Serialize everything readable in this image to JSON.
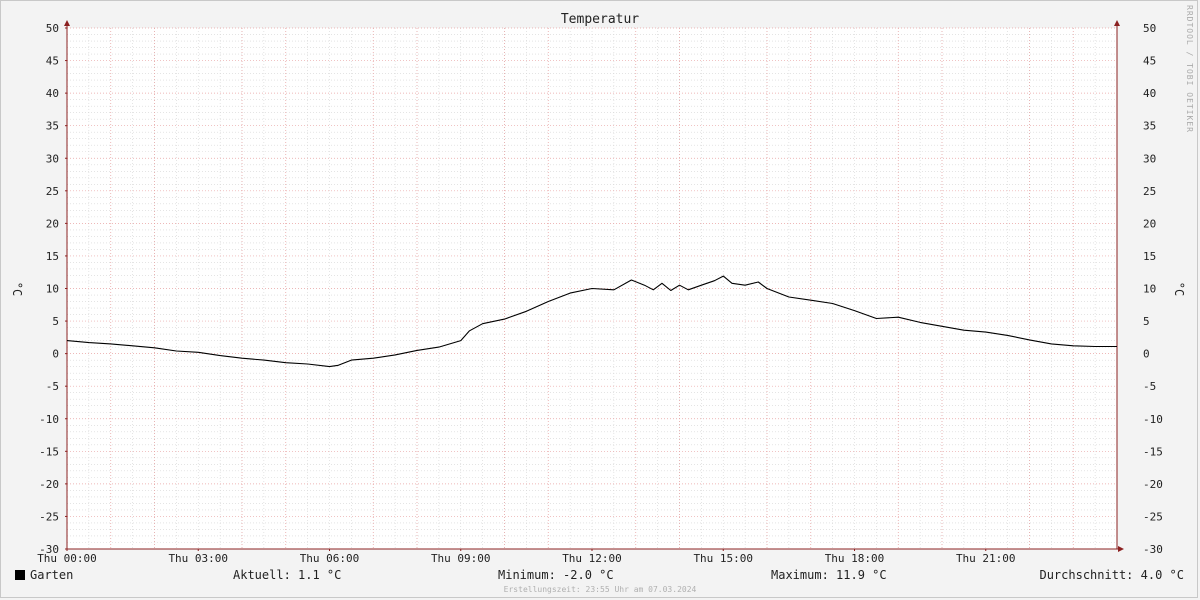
{
  "chart_data": {
    "type": "line",
    "title": "Temperatur",
    "ylabel": "°C",
    "ylabel_right": "°C",
    "ylim": [
      -30,
      50
    ],
    "y_ticks": [
      50,
      45,
      40,
      35,
      30,
      25,
      20,
      15,
      10,
      5,
      0,
      -5,
      -10,
      -15,
      -20,
      -25,
      -30
    ],
    "x_ticks": [
      {
        "hour": 0,
        "label": "Thu 00:00"
      },
      {
        "hour": 3,
        "label": "Thu 03:00"
      },
      {
        "hour": 6,
        "label": "Thu 06:00"
      },
      {
        "hour": 9,
        "label": "Thu 09:00"
      },
      {
        "hour": 12,
        "label": "Thu 12:00"
      },
      {
        "hour": 15,
        "label": "Thu 15:00"
      },
      {
        "hour": 18,
        "label": "Thu 18:00"
      },
      {
        "hour": 21,
        "label": "Thu 21:00"
      }
    ],
    "xlim_hours": [
      0,
      24
    ],
    "grid": true,
    "series": [
      {
        "name": "Garten",
        "color": "#000000",
        "x_hours": [
          0,
          0.5,
          1,
          1.5,
          2,
          2.5,
          3,
          3.5,
          4,
          4.5,
          5,
          5.5,
          6,
          6.2,
          6.5,
          7,
          7.5,
          8,
          8.5,
          9,
          9.2,
          9.5,
          10,
          10.5,
          11,
          11.5,
          12,
          12.5,
          12.9,
          13.2,
          13.4,
          13.6,
          13.8,
          14.0,
          14.2,
          14.5,
          14.8,
          15.0,
          15.2,
          15.5,
          15.8,
          16,
          16.5,
          17,
          17.5,
          18,
          18.5,
          19,
          19.5,
          20,
          20.5,
          21,
          21.5,
          22,
          22.5,
          23,
          23.5,
          24
        ],
        "values": [
          2.0,
          1.7,
          1.5,
          1.2,
          0.9,
          0.4,
          0.2,
          -0.3,
          -0.7,
          -1.0,
          -1.4,
          -1.6,
          -2.0,
          -1.8,
          -1.0,
          -0.7,
          -0.2,
          0.5,
          1.0,
          2.0,
          3.5,
          4.6,
          5.3,
          6.5,
          8.0,
          9.3,
          10.0,
          9.8,
          11.3,
          10.5,
          9.8,
          10.8,
          9.7,
          10.5,
          9.8,
          10.5,
          11.2,
          11.9,
          10.8,
          10.5,
          11.0,
          10.0,
          8.7,
          8.2,
          7.7,
          6.6,
          5.4,
          5.6,
          4.8,
          4.2,
          3.6,
          3.3,
          2.8,
          2.1,
          1.5,
          1.2,
          1.1,
          1.1
        ]
      }
    ],
    "legend_position": "bottom-left"
  },
  "legend": {
    "series_name": "Garten",
    "current_label": "Aktuell:",
    "current_value": "1.1 °C",
    "min_label": "Minimum:",
    "min_value": "-2.0 °C",
    "max_label": "Maximum:",
    "max_value": "11.9 °C",
    "avg_label": "Durchschnitt:",
    "avg_value": "4.0 °C"
  },
  "footer": "Erstellungszeit: 23:55 Uhr am 07.03.2024",
  "watermark": "RRDTOOL / TOBI OETIKER",
  "colors": {
    "background": "#f3f3f3",
    "plot_background": "#ffffff",
    "major_grid": "#e8a0a0",
    "minor_grid": "#d4d4d4",
    "axis": "#8b2020",
    "line": "#000000"
  }
}
